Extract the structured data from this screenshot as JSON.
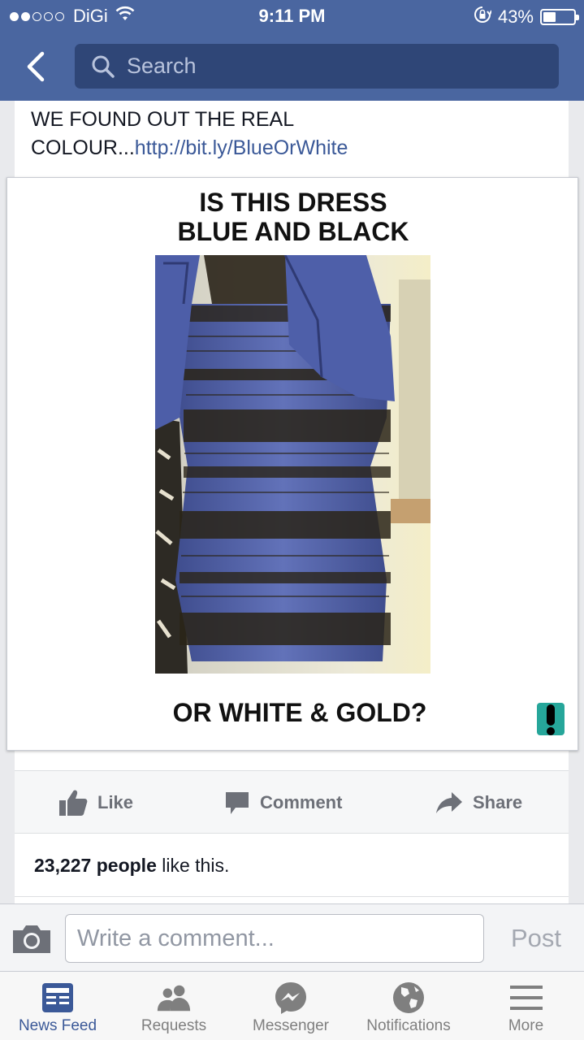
{
  "status_bar": {
    "signal_bars": 5,
    "signal_filled": 2,
    "carrier": "DiGi",
    "time": "9:11 PM",
    "battery_percent_text": "43%",
    "battery_level": 0.43
  },
  "header": {
    "search_placeholder": "Search",
    "back_icon": "chevron-left-icon",
    "search_icon": "magnifier-icon"
  },
  "post": {
    "text_prefix": "WE FOUND OUT THE REAL COLOUR...",
    "link_text": "http://bit.ly/BlueOrWhite",
    "image": {
      "headline_line1": "IS THIS DRESS",
      "headline_line2": "BLUE AND BLACK",
      "footline": "OR WHITE & GOLD?",
      "photo_description_icon": "dress-photo"
    }
  },
  "actions": {
    "like": "Like",
    "comment": "Comment",
    "share": "Share"
  },
  "likes": {
    "count_text": "23,227 people",
    "suffix": " like this."
  },
  "composer": {
    "placeholder": "Write a comment...",
    "post_label": "Post"
  },
  "tabbar": {
    "items": [
      {
        "label": "News Feed",
        "icon": "news-feed-icon",
        "active": true
      },
      {
        "label": "Requests",
        "icon": "friends-icon",
        "active": false
      },
      {
        "label": "Messenger",
        "icon": "messenger-icon",
        "active": false
      },
      {
        "label": "Notifications",
        "icon": "globe-icon",
        "active": false
      },
      {
        "label": "More",
        "icon": "hamburger-icon",
        "active": false
      }
    ]
  },
  "colors": {
    "header_blue": "#4a66a0",
    "search_bg": "#2f4677",
    "link": "#3b5998",
    "tab_active": "#3b5998",
    "tab_inactive": "#7f7f7f",
    "dress_blue": "#4f5fa6",
    "dress_lace": "#2a2418",
    "brand_teal": "#26a69a"
  }
}
